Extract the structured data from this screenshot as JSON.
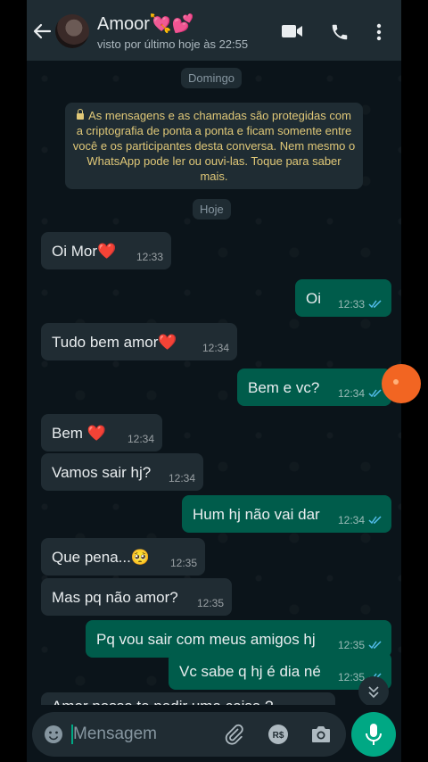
{
  "header": {
    "title": "Amoor💘💕",
    "subtitle": "visto por último hoje às 22:55"
  },
  "chat": {
    "date_sunday": "Domingo",
    "notice": "As mensagens e as chamadas são protegidas com a criptografia de ponta a ponta e ficam somente entre você e os participantes desta conversa. Nem mesmo o WhatsApp pode ler ou ouvi-las. Toque para saber mais.",
    "date_today": "Hoje",
    "messages": [
      {
        "text": "Oi Mor",
        "emoji": "❤️",
        "time": "12:33"
      },
      {
        "text": "Oi",
        "time": "12:33"
      },
      {
        "text": "Tudo bem amor",
        "emoji": "❤️",
        "time": "12:34"
      },
      {
        "text": "Bem e vc?",
        "time": "12:34"
      },
      {
        "text": "Bem ",
        "emoji": "❤️",
        "time": "12:34"
      },
      {
        "text": "Vamos sair hj?",
        "time": "12:34"
      },
      {
        "text": "Hum hj não vai dar",
        "time": "12:34"
      },
      {
        "text": "Que pena...",
        "emoji": "🥺",
        "time": "12:35"
      },
      {
        "text": "Mas pq não amor?",
        "time": "12:35"
      },
      {
        "text": "Pq vou sair com meus amigos hj",
        "time": "12:35"
      },
      {
        "text": "Vc sabe q hj é dia né",
        "time": "12:35"
      },
      {
        "text": "Amor posso te pedir uma coisa ?"
      }
    ]
  },
  "composer": {
    "placeholder": "Mensagem"
  },
  "icons": {
    "back": "arrow-left-icon",
    "video": "video-call-icon",
    "phone": "phone-icon",
    "menu": "more-vertical-icon",
    "emoji": "emoji-icon",
    "attach": "paperclip-icon",
    "payment": "payment-rs-icon",
    "camera": "camera-icon",
    "mic": "mic-icon",
    "scroll": "scroll-down-icon"
  },
  "colors": {
    "incoming_bubble": "#202c33",
    "outgoing_bubble": "#005c4b",
    "accent": "#00a884",
    "read_ticks": "#53bdeb"
  }
}
